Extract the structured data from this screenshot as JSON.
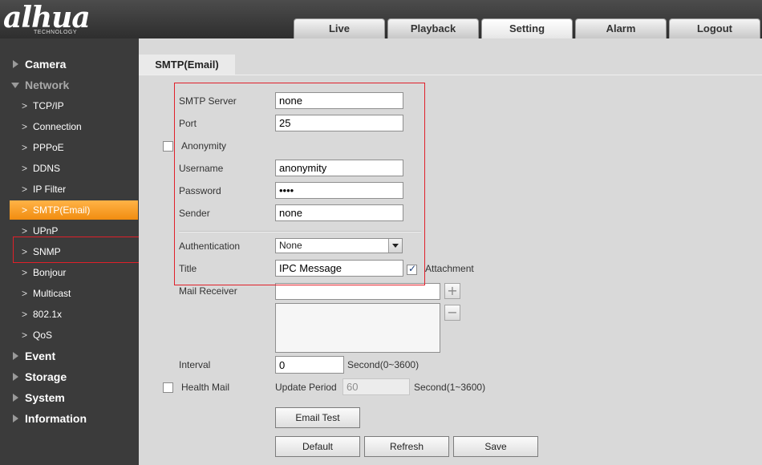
{
  "brand": {
    "logo": "alhua",
    "logo_sub": "TECHNOLOGY"
  },
  "nav_tabs": [
    "Live",
    "Playback",
    "Setting",
    "Alarm",
    "Logout"
  ],
  "sidebar": {
    "items": [
      {
        "label": "Camera",
        "kind": "category"
      },
      {
        "label": "Network",
        "kind": "category",
        "expanded": true
      },
      {
        "label": "TCP/IP",
        "kind": "sub"
      },
      {
        "label": "Connection",
        "kind": "sub"
      },
      {
        "label": "PPPoE",
        "kind": "sub"
      },
      {
        "label": "DDNS",
        "kind": "sub"
      },
      {
        "label": "IP Filter",
        "kind": "sub"
      },
      {
        "label": "SMTP(Email)",
        "kind": "sub",
        "active": true
      },
      {
        "label": "UPnP",
        "kind": "sub"
      },
      {
        "label": "SNMP",
        "kind": "sub"
      },
      {
        "label": "Bonjour",
        "kind": "sub"
      },
      {
        "label": "Multicast",
        "kind": "sub"
      },
      {
        "label": "802.1x",
        "kind": "sub"
      },
      {
        "label": "QoS",
        "kind": "sub"
      },
      {
        "label": "Event",
        "kind": "category"
      },
      {
        "label": "Storage",
        "kind": "category"
      },
      {
        "label": "System",
        "kind": "category"
      },
      {
        "label": "Information",
        "kind": "category"
      }
    ]
  },
  "page_tab": "SMTP(Email)",
  "form": {
    "smtp_server": {
      "label": "SMTP Server",
      "value": "none"
    },
    "port": {
      "label": "Port",
      "value": "25"
    },
    "anonymity": {
      "label": "Anonymity",
      "checked": false
    },
    "username": {
      "label": "Username",
      "value": "anonymity"
    },
    "password": {
      "label": "Password",
      "value": "••••"
    },
    "sender": {
      "label": "Sender",
      "value": "none"
    },
    "authentication": {
      "label": "Authentication",
      "value": "None"
    },
    "title": {
      "label": "Title",
      "value": "IPC Message"
    },
    "attachment": {
      "label": "Attachment",
      "checked": true
    },
    "mail_receiver": {
      "label": "Mail Receiver",
      "value": ""
    },
    "interval": {
      "label": "Interval",
      "value": "0",
      "unit": "Second(0~3600)"
    },
    "health_mail": {
      "label": "Health Mail",
      "checked": false
    },
    "update_period": {
      "label": "Update Period",
      "value": "60",
      "unit": "Second(1~3600)"
    }
  },
  "buttons": {
    "email_test": "Email Test",
    "default": "Default",
    "refresh": "Refresh",
    "save": "Save",
    "add": "+",
    "remove": "−"
  },
  "colors": {
    "accent": "#f5961a",
    "highlight_box": "#e0202a",
    "sidebar_bg": "#3b3b3b"
  }
}
